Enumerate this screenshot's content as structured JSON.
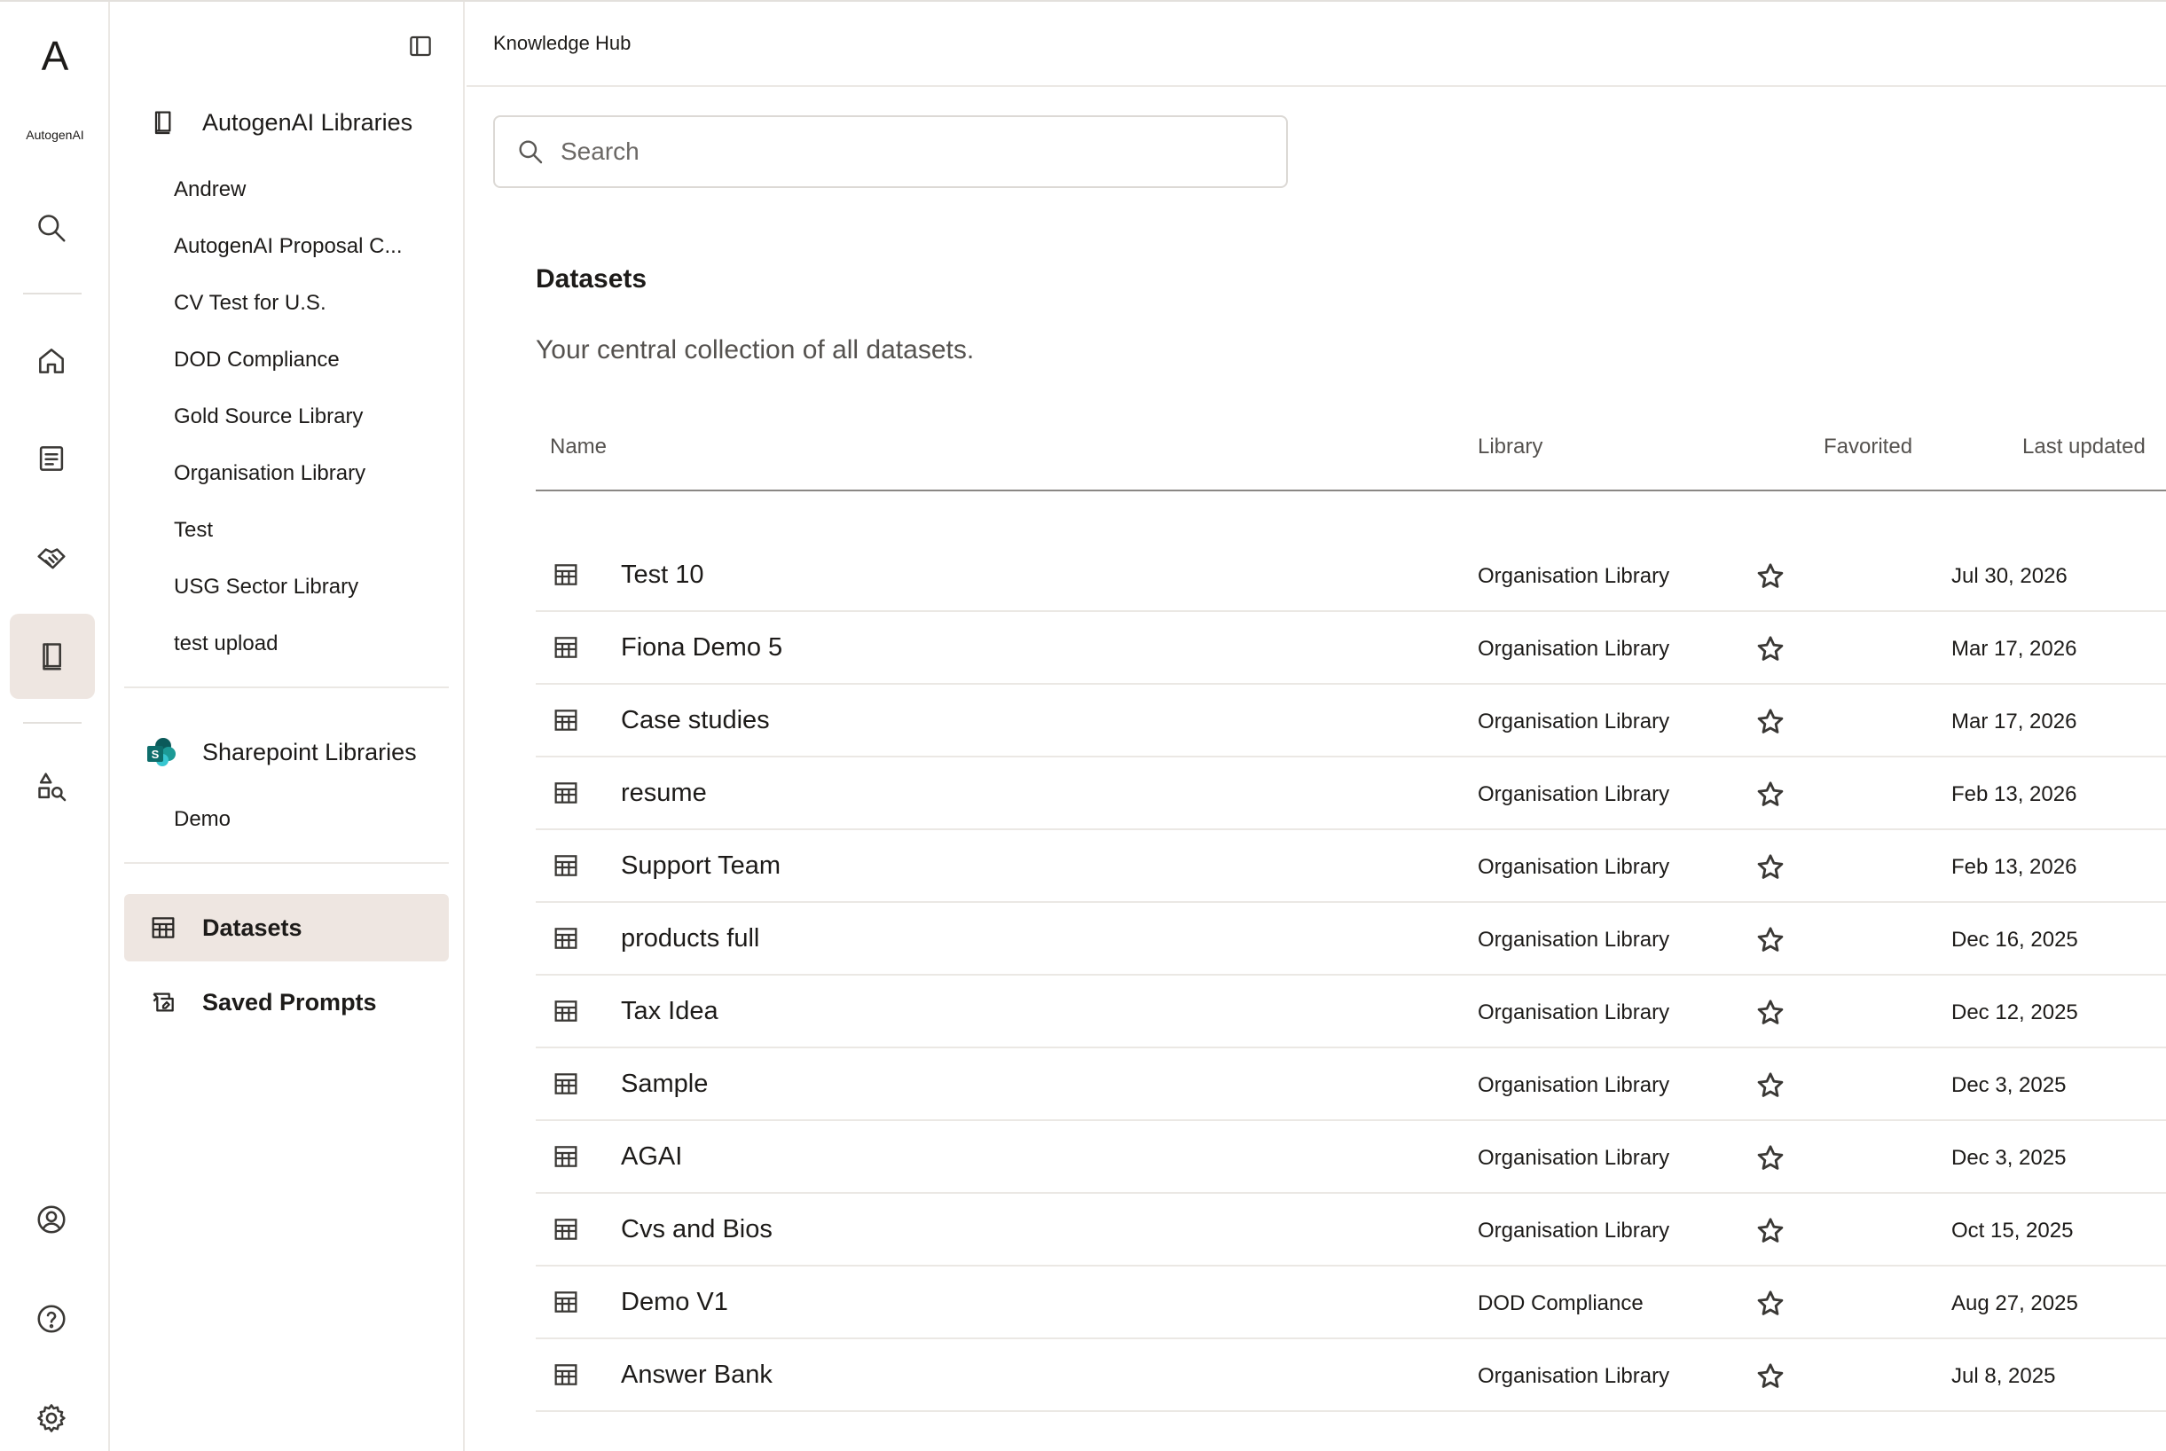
{
  "brand": {
    "letter": "A",
    "name": "AutogenAI"
  },
  "rail": {
    "items": [
      {
        "name": "search-icon"
      },
      {
        "name": "home-icon"
      },
      {
        "name": "document-icon"
      },
      {
        "name": "handshake-icon"
      },
      {
        "name": "library-icon",
        "active": true
      },
      {
        "name": "shapes-search-icon"
      },
      {
        "name": "user-profile-icon"
      },
      {
        "name": "help-icon"
      },
      {
        "name": "settings-icon"
      }
    ]
  },
  "sidebar": {
    "autogen_group": {
      "label": "AutogenAI Libraries",
      "items": [
        "Andrew",
        "AutogenAI Proposal C...",
        "CV Test for U.S.",
        "DOD Compliance",
        "Gold Source Library",
        "Organisation Library",
        "Test",
        "USG Sector Library",
        "test upload"
      ]
    },
    "sharepoint_group": {
      "label": "Sharepoint Libraries",
      "items": [
        "Demo"
      ]
    },
    "nav": {
      "datasets": "Datasets",
      "saved_prompts": "Saved Prompts"
    }
  },
  "header": {
    "title": "Knowledge Hub"
  },
  "search": {
    "placeholder": "Search",
    "value": ""
  },
  "section": {
    "title": "Datasets",
    "description": "Your central collection of all datasets."
  },
  "table": {
    "columns": {
      "name": "Name",
      "library": "Library",
      "favorited": "Favorited",
      "last_updated": "Last updated"
    },
    "rows": [
      {
        "name": "Test 10",
        "library": "Organisation Library",
        "favorited": false,
        "last_updated": "Jul 30, 2026"
      },
      {
        "name": "Fiona Demo 5",
        "library": "Organisation Library",
        "favorited": false,
        "last_updated": "Mar 17, 2026"
      },
      {
        "name": "Case studies",
        "library": "Organisation Library",
        "favorited": false,
        "last_updated": "Mar 17, 2026"
      },
      {
        "name": "resume",
        "library": "Organisation Library",
        "favorited": false,
        "last_updated": "Feb 13, 2026"
      },
      {
        "name": "Support Team",
        "library": "Organisation Library",
        "favorited": false,
        "last_updated": "Feb 13, 2026"
      },
      {
        "name": "products full",
        "library": "Organisation Library",
        "favorited": false,
        "last_updated": "Dec 16, 2025"
      },
      {
        "name": "Tax Idea",
        "library": "Organisation Library",
        "favorited": false,
        "last_updated": "Dec 12, 2025"
      },
      {
        "name": "Sample",
        "library": "Organisation Library",
        "favorited": false,
        "last_updated": "Dec 3, 2025"
      },
      {
        "name": "AGAI",
        "library": "Organisation Library",
        "favorited": false,
        "last_updated": "Dec 3, 2025"
      },
      {
        "name": "Cvs and Bios",
        "library": "Organisation Library",
        "favorited": false,
        "last_updated": "Oct 15, 2025"
      },
      {
        "name": "Demo V1",
        "library": "DOD Compliance",
        "favorited": false,
        "last_updated": "Aug 27, 2025"
      },
      {
        "name": "Answer Bank",
        "library": "Organisation Library",
        "favorited": false,
        "last_updated": "Jul 8, 2025"
      }
    ]
  },
  "colors": {
    "active_bg": "#eee6e1",
    "divider": "#ebe8e4",
    "text": "#1d1b19",
    "muted": "#55524f",
    "sharepoint_teal": "#1c7a78"
  }
}
